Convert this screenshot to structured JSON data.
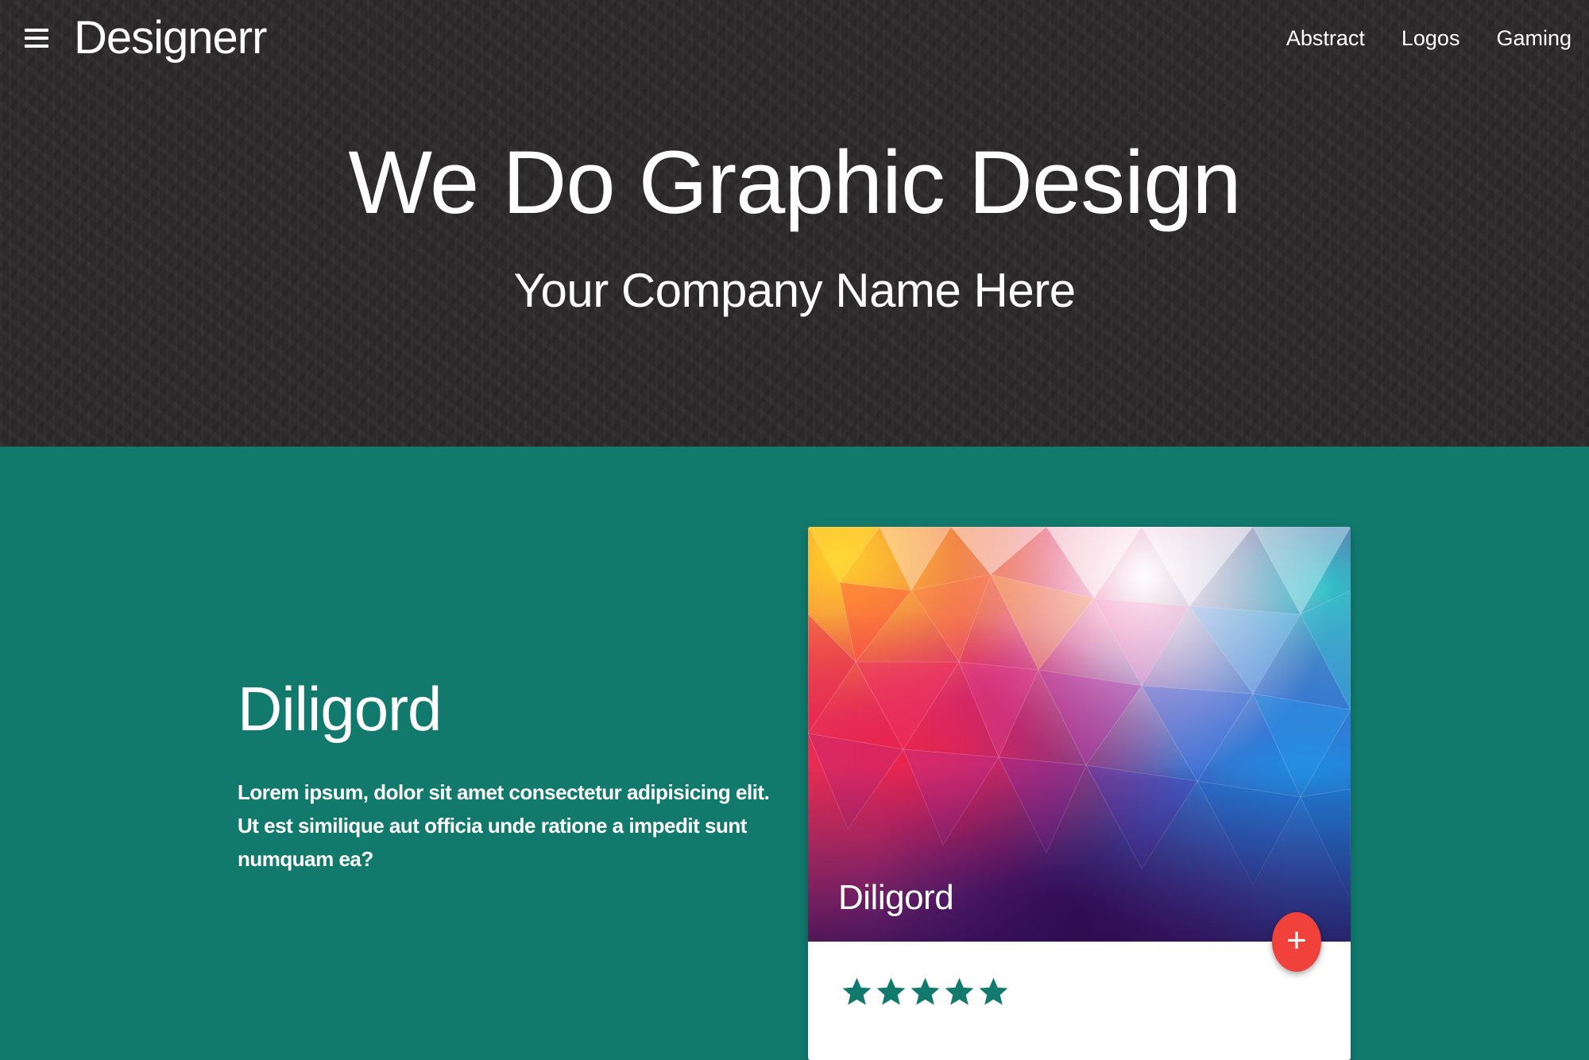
{
  "nav": {
    "menu_icon": "menu-icon",
    "brand": "Designerr",
    "links": [
      {
        "label": "Abstract"
      },
      {
        "label": "Logos"
      },
      {
        "label": "Gaming"
      }
    ]
  },
  "hero": {
    "title": "We Do Graphic Design",
    "subtitle": "Your Company Name Here"
  },
  "feature": {
    "heading": "Diligord",
    "text": "Lorem ipsum, dolor sit amet consectetur adipisicing elit. Ut est similique aut officia unde ratione a impedit sunt numquam ea?",
    "background_color": "#117a6d"
  },
  "card": {
    "caption": "Diligord",
    "fab_label": "+",
    "fab_color": "#f0423a",
    "rating": 5,
    "rating_max": 5,
    "star_color": "#117a6d"
  },
  "colors": {
    "hero_background": "#2c2a2a",
    "text": "#ffffff"
  }
}
